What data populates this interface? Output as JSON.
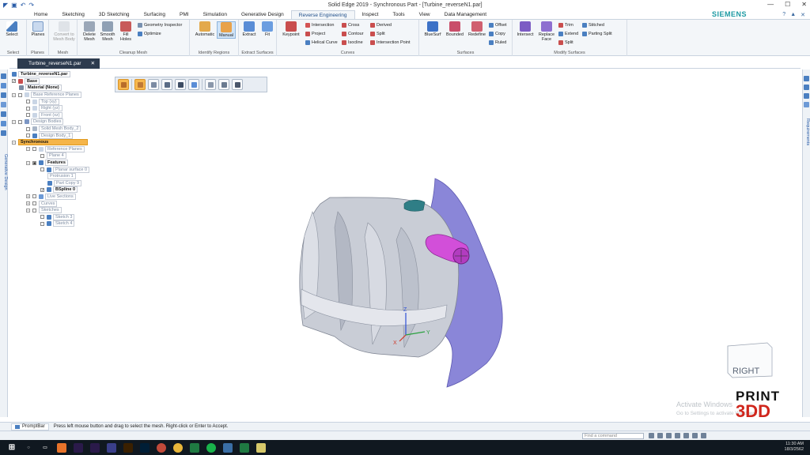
{
  "app": {
    "title": "Solid Edge 2019 - Synchronous Part - [Turbine_reverseN1.par]",
    "brand": "SIEMENS"
  },
  "tabs": [
    "Home",
    "Sketching",
    "3D Sketching",
    "Surfacing",
    "PMI",
    "Simulation",
    "Generative Design",
    "Reverse Engineering",
    "Inspect",
    "Tools",
    "View",
    "Data Management"
  ],
  "ribbon": {
    "select": {
      "label": "Select",
      "group": "Select"
    },
    "planes": {
      "label": "Planes",
      "group": "Planes"
    },
    "mesh": {
      "convert": "Convert to Mesh Body",
      "group": "Mesh"
    },
    "cleanup": {
      "delete": "Delete Mesh",
      "smooth": "Smooth Mesh",
      "fill": "Fill Holes",
      "geometry_inspector": "Geometry Inspector",
      "optimize": "Optimize",
      "group": "Cleanup Mesh"
    },
    "regions": {
      "automatic": "Automatic",
      "manual": "Manual",
      "group": "Identify Regions"
    },
    "extract": {
      "extract": "Extract",
      "fit": "Fit",
      "group": "Extract Surfaces"
    },
    "curves": {
      "keypoint": "Keypoint",
      "intersection": "Intersection",
      "project": "Project",
      "helical": "Helical Curve",
      "cross": "Cross",
      "contour": "Contour",
      "isocline": "Isocline",
      "derived": "Derived",
      "split": "Split",
      "intersection_point": "Intersection Point",
      "group": "Curves"
    },
    "surfaces": {
      "bluesurf": "BlueSurf",
      "bounded": "Bounded",
      "redefine": "Redefine",
      "offset": "Offset",
      "copy": "Copy",
      "ruled": "Ruled",
      "group": "Surfaces"
    },
    "modify": {
      "intersect": "Intersect",
      "replace_face": "Replace Face",
      "trim": "Trim",
      "extend": "Extend",
      "split": "Split",
      "stitched": "Stitched",
      "parting_split": "Parting Split",
      "group": "Modify Surfaces"
    }
  },
  "document_tab": "Turbine_reverseN1.par",
  "tree": {
    "root": "Turbine_reverseN1.par",
    "items": [
      "Base",
      "Material (None)",
      "Base Reference Planes",
      "Top (xy)",
      "Right (yz)",
      "Front (xz)",
      "Design Bodies",
      "Solid Mesh Body_2",
      "Design Body_1",
      "Synchronous",
      "Reference Planes",
      "Plane 4",
      "Features",
      "Planar surface 0",
      "Protrusion 1",
      "Part Copy 9",
      "BSpline 0",
      "Live Sections",
      "Curves",
      "Sketches",
      "Sketch 3",
      "Sketch 4"
    ]
  },
  "left_panel_label": "Generative Design",
  "right_panel_label": "Requirements",
  "view_cube_label": "RIGHT",
  "triad": {
    "x": "X",
    "y": "Y",
    "z": "Z"
  },
  "watermark": {
    "line1": "Activate Windows",
    "line2": "Go to Settings to activate Windows."
  },
  "logo": {
    "text1": "PRINT",
    "text2": "3DD"
  },
  "prompt": {
    "label": "PromptBar",
    "message": "Press left mouse button and drag to select the mesh. Right-click or Enter to Accept."
  },
  "status": {
    "find_placeholder": "Find a command"
  },
  "taskbar": {
    "time": "11:30 AM",
    "date": "18/3/2562"
  },
  "colors": {
    "accent": "#f5b54a",
    "mesh": "#c9cdd6",
    "surface": "#8a86d8",
    "highlight": "#d24fd9"
  }
}
